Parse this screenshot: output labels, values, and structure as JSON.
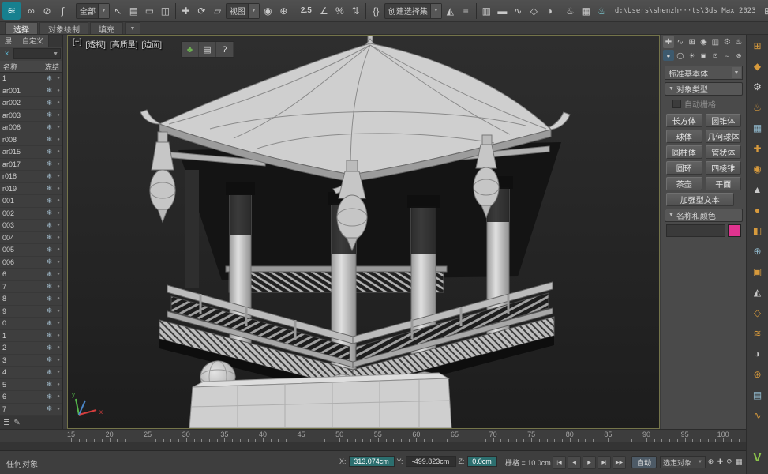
{
  "toolbar": {
    "items": [
      {
        "t": "logo",
        "name": "max-logo",
        "glyph": "≋"
      },
      {
        "t": "icon",
        "name": "select-and-link-icon",
        "glyph": "∞"
      },
      {
        "t": "icon",
        "name": "unlink-selection-icon",
        "glyph": "⊘"
      },
      {
        "t": "icon",
        "name": "bind-to-spacewarp-icon",
        "glyph": "∫"
      },
      {
        "t": "sep"
      },
      {
        "t": "dd",
        "name": "selection-filter-dropdown",
        "label": "全部"
      },
      {
        "t": "icon",
        "name": "select-object-icon",
        "glyph": "↖"
      },
      {
        "t": "icon",
        "name": "select-by-name-icon",
        "glyph": "▤"
      },
      {
        "t": "icon",
        "name": "rectangular-selection-icon",
        "glyph": "▭"
      },
      {
        "t": "icon",
        "name": "window-crossing-icon",
        "glyph": "◫"
      },
      {
        "t": "sep"
      },
      {
        "t": "icon",
        "name": "move-icon",
        "glyph": "✚"
      },
      {
        "t": "icon",
        "name": "rotate-icon",
        "glyph": "⟳"
      },
      {
        "t": "icon",
        "name": "scale-icon",
        "glyph": "▱"
      },
      {
        "t": "dd",
        "name": "reference-coordinate-dropdown",
        "label": "视图"
      },
      {
        "t": "icon",
        "name": "use-pivot-center-icon",
        "glyph": "◉"
      },
      {
        "t": "icon",
        "name": "select-and-manipulate-icon",
        "glyph": "⊕"
      },
      {
        "t": "sep"
      },
      {
        "t": "icon",
        "name": "snap-toggle-icon",
        "glyph": "2.5",
        "wide": true
      },
      {
        "t": "icon",
        "name": "angle-snap-icon",
        "glyph": "∠"
      },
      {
        "t": "icon",
        "name": "percent-snap-icon",
        "glyph": "%"
      },
      {
        "t": "icon",
        "name": "spinner-snap-icon",
        "glyph": "⇅"
      },
      {
        "t": "sep"
      },
      {
        "t": "icon",
        "name": "edit-named-sets-icon",
        "glyph": "{}"
      },
      {
        "t": "dd",
        "name": "named-selection-sets-dropdown",
        "label": "创建选择集"
      },
      {
        "t": "icon",
        "name": "mirror-icon",
        "glyph": "◭"
      },
      {
        "t": "icon",
        "name": "align-icon",
        "glyph": "≡"
      },
      {
        "t": "sep"
      },
      {
        "t": "icon",
        "name": "scene-explorer-toggle-icon",
        "glyph": "▥"
      },
      {
        "t": "icon",
        "name": "ribbon-toggle-icon",
        "glyph": "▬"
      },
      {
        "t": "icon",
        "name": "curve-editor-icon",
        "glyph": "∿"
      },
      {
        "t": "icon",
        "name": "schematic-view-icon",
        "glyph": "◇"
      },
      {
        "t": "icon",
        "name": "material-editor-icon",
        "glyph": "◑"
      },
      {
        "t": "sep"
      },
      {
        "t": "icon",
        "name": "render-setup-icon",
        "glyph": "♨"
      },
      {
        "t": "icon",
        "name": "rendered-frame-icon",
        "glyph": "▦"
      },
      {
        "t": "icon",
        "name": "render-production-icon",
        "glyph": "♨",
        "fg": "#7fd0d8"
      },
      {
        "t": "spacer"
      },
      {
        "t": "path",
        "name": "file-path",
        "label": "d:\\Users\\shenzh···ts\\3ds Max 2023"
      },
      {
        "t": "icon",
        "name": "workspace-icon",
        "glyph": "⊞"
      },
      {
        "t": "icon",
        "name": "layout-icon",
        "glyph": "▣"
      },
      {
        "t": "icon",
        "name": "settings-icon",
        "glyph": "⚙"
      }
    ]
  },
  "ribbon": {
    "tabs": [
      {
        "id": "selection",
        "label": "选择",
        "active": true
      },
      {
        "id": "object-paint",
        "label": "对象绘制",
        "active": false
      },
      {
        "id": "populate",
        "label": "填充",
        "active": false
      }
    ]
  },
  "scene_explorer": {
    "tab_layers": "层",
    "tab_custom": "自定义",
    "filter_clear": "×",
    "col_name": "名称",
    "col_freeze": "冻结",
    "freeze_glyph": "❄",
    "rows": [
      "1",
      "ar001",
      "ar002",
      "ar003",
      "ar006",
      "r008",
      "ar015",
      "ar017",
      "r018",
      "r019",
      "001",
      "002",
      "003",
      "004",
      "005",
      "006",
      "6",
      "7",
      "8",
      "9",
      "0",
      "1",
      "2",
      "3",
      "4",
      "5",
      "6",
      "7"
    ],
    "footer_icons": [
      {
        "name": "layer-list-footer-icon",
        "glyph": "≣"
      },
      {
        "name": "edit-footer-icon",
        "glyph": "✎"
      }
    ]
  },
  "viewport": {
    "labels": [
      {
        "name": "viewport-general-menu",
        "text": "[+]"
      },
      {
        "name": "viewport-pov-menu",
        "text": "[透视]"
      },
      {
        "name": "viewport-quality-menu",
        "text": "[高质量]"
      },
      {
        "name": "viewport-shading-menu",
        "text": "[边面]"
      }
    ],
    "float_toolbar": [
      {
        "name": "forest-tool-button",
        "glyph": "♣",
        "color": "#6db052"
      },
      {
        "name": "notes-tool-button",
        "glyph": "▤",
        "color": "#dcdcdc"
      },
      {
        "name": "help-tool-button",
        "glyph": "?",
        "color": "#dcdcdc"
      }
    ]
  },
  "command_panel": {
    "tabs": [
      {
        "name": "create-tab",
        "glyph": "✚",
        "active": true
      },
      {
        "name": "modify-tab",
        "glyph": "∿",
        "active": false
      },
      {
        "name": "hierarchy-tab",
        "glyph": "⊞",
        "active": false
      },
      {
        "name": "motion-tab",
        "glyph": "◉",
        "active": false
      },
      {
        "name": "display-tab",
        "glyph": "▥",
        "active": false
      },
      {
        "name": "utilities-tab",
        "glyph": "⚙",
        "active": false
      },
      {
        "name": "teapot-icon",
        "glyph": "♨",
        "color": "#f0f0f0",
        "active": false
      }
    ],
    "categories": [
      {
        "name": "geometry-category",
        "glyph": "●",
        "active": true
      },
      {
        "name": "shapes-category",
        "glyph": "◯",
        "active": false
      },
      {
        "name": "lights-category",
        "glyph": "☀",
        "active": false
      },
      {
        "name": "cameras-category",
        "glyph": "▣",
        "active": false
      },
      {
        "name": "helpers-category",
        "glyph": "⊡",
        "active": false
      },
      {
        "name": "spacewarps-category",
        "glyph": "≈",
        "active": false
      },
      {
        "name": "systems-category",
        "glyph": "⊛",
        "active": false
      }
    ],
    "subcategory_dropdown": "标准基本体",
    "rollout_object_type": "对象类型",
    "autogrid_label": "自动栅格",
    "object_buttons": [
      "长方体",
      "圆锥体",
      "球体",
      "几何球体",
      "圆柱体",
      "管状体",
      "圆环",
      "四棱锥",
      "茶壶",
      "平面",
      "加强型文本"
    ],
    "rollout_name_color": "名称和颜色",
    "color_swatch": "#e0338f"
  },
  "right_strip": {
    "icons": [
      {
        "name": "strip-tool-icon-1",
        "glyph": "⊞",
        "color": "#d79a3c"
      },
      {
        "name": "strip-tool-icon-2",
        "glyph": "◆",
        "color": "#d79a3c"
      },
      {
        "name": "strip-tool-icon-3",
        "glyph": "⚙",
        "color": "#c9c9c9"
      },
      {
        "name": "strip-tool-icon-4",
        "glyph": "♨",
        "color": "#d79a3c"
      },
      {
        "name": "strip-tool-icon-5",
        "glyph": "▦",
        "color": "#8fb6c9"
      },
      {
        "name": "strip-tool-icon-6",
        "glyph": "✚",
        "color": "#d79a3c"
      },
      {
        "name": "strip-tool-icon-7",
        "glyph": "◉",
        "color": "#d79a3c"
      },
      {
        "name": "strip-tool-icon-8",
        "glyph": "▲",
        "color": "#c9c9c9"
      },
      {
        "name": "strip-tool-icon-9",
        "glyph": "●",
        "color": "#d79a3c"
      },
      {
        "name": "strip-tool-icon-10",
        "glyph": "◧",
        "color": "#d79a3c"
      },
      {
        "name": "strip-tool-icon-11",
        "glyph": "⊕",
        "color": "#8fb6c9"
      },
      {
        "name": "strip-tool-icon-12",
        "glyph": "▣",
        "color": "#d79a3c"
      },
      {
        "name": "strip-tool-icon-13",
        "glyph": "◭",
        "color": "#c9c9c9"
      },
      {
        "name": "strip-tool-icon-14",
        "glyph": "◇",
        "color": "#d79a3c"
      },
      {
        "name": "strip-tool-icon-15",
        "glyph": "≋",
        "color": "#d79a3c"
      },
      {
        "name": "strip-tool-icon-16",
        "glyph": "◑",
        "color": "#c9c9c9"
      },
      {
        "name": "strip-tool-icon-17",
        "glyph": "⊛",
        "color": "#d79a3c"
      },
      {
        "name": "strip-tool-icon-18",
        "glyph": "▤",
        "color": "#8fb6c9"
      },
      {
        "name": "strip-tool-icon-19",
        "glyph": "∿",
        "color": "#d79a3c"
      }
    ],
    "vray": {
      "name": "vray-logo",
      "glyph": "V",
      "color": "#8bc34a"
    }
  },
  "timeline": {
    "labels": [
      "15",
      "20",
      "25",
      "30",
      "35",
      "40",
      "45",
      "50",
      "55",
      "60",
      "65",
      "70",
      "75",
      "80",
      "85",
      "90",
      "95",
      "100"
    ]
  },
  "statusbar": {
    "prompt": "任何对象",
    "coord_x_label": "X:",
    "coord_x": "313.074cm",
    "coord_y_label": "Y:",
    "coord_y": "-499.823cm",
    "coord_z_label": "Z:",
    "coord_z": "0.0cm",
    "grid_label": "栅格 = 10.0cm",
    "transport": [
      {
        "name": "go-to-start-button",
        "glyph": "|◀"
      },
      {
        "name": "previous-frame-button",
        "glyph": "◀"
      },
      {
        "name": "play-button",
        "glyph": "▶"
      },
      {
        "name": "next-frame-button",
        "glyph": "▶|"
      },
      {
        "name": "go-to-end-button",
        "glyph": "▶▶"
      }
    ],
    "auto_key_label": "自动",
    "selection_set_label": "选定对象",
    "nav_icons": [
      {
        "name": "zoom-icon",
        "glyph": "⊕"
      },
      {
        "name": "pan-icon",
        "glyph": "✚"
      },
      {
        "name": "orbit-icon",
        "glyph": "⟳"
      },
      {
        "name": "maximize-viewport-icon",
        "glyph": "▦"
      }
    ]
  }
}
